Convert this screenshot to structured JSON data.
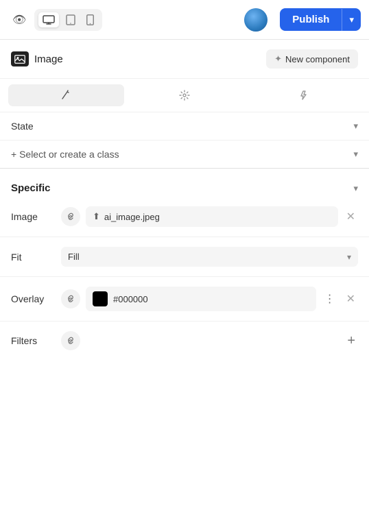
{
  "header": {
    "eye_label": "👁",
    "devices": [
      {
        "id": "desktop",
        "icon": "🖥",
        "label": "Desktop",
        "active": true
      },
      {
        "id": "tablet",
        "icon": "⬜",
        "label": "Tablet",
        "active": false
      },
      {
        "id": "mobile",
        "icon": "📱",
        "label": "Mobile",
        "active": false
      }
    ],
    "publish_label": "Publish",
    "publish_chevron": "▾"
  },
  "panel": {
    "title": "Image",
    "new_component_label": "New component",
    "tabs": [
      {
        "id": "style",
        "icon": "✏",
        "label": "Style",
        "active": true
      },
      {
        "id": "settings",
        "icon": "⚙",
        "label": "Settings",
        "active": false
      },
      {
        "id": "interactions",
        "icon": "⚡",
        "label": "Interactions",
        "active": false
      }
    ],
    "state_label": "State",
    "class_label": "+ Select or create a class",
    "specific_section": {
      "title": "Specific",
      "image_label": "Image",
      "image_value": "ai_image.jpeg",
      "fit_label": "Fit",
      "fit_value": "Fill",
      "overlay_label": "Overlay",
      "overlay_color": "#000000",
      "overlay_hex": "#000000",
      "filters_label": "Filters"
    }
  }
}
